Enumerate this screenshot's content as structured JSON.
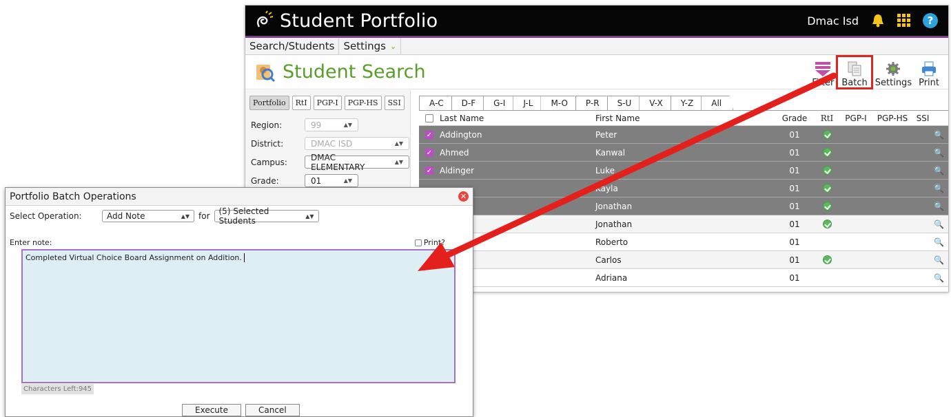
{
  "app": {
    "title": "Student Portfolio",
    "user": "Dmac Isd"
  },
  "menu": {
    "search_students": "Search/Students",
    "settings": "Settings"
  },
  "page": {
    "title": "Student Search"
  },
  "toolbar": {
    "filter": "Filter",
    "batch": "Batch",
    "settings": "Settings",
    "print": "Print"
  },
  "filters": {
    "module_tabs": [
      "Portfolio",
      "RtI",
      "PGP-I",
      "PGP-HS",
      "SSI"
    ],
    "region_label": "Region:",
    "region_value": "99",
    "district_label": "District:",
    "district_value": "DMAC ISD",
    "campus_label": "Campus:",
    "campus_value": "DMAC ELEMENTARY",
    "grade_label": "Grade:",
    "grade_value": "01"
  },
  "alpha_tabs": [
    "A-C",
    "D-F",
    "G-I",
    "J-L",
    "M-O",
    "P-R",
    "S-U",
    "V-X",
    "Y-Z",
    "All"
  ],
  "grid": {
    "headers": {
      "last": "Last Name",
      "first": "First Name",
      "grade": "Grade",
      "rti": "RtI",
      "pgpi": "PGP-I",
      "pgphs": "PGP-HS",
      "ssi": "SSI"
    },
    "rows": [
      {
        "last": "Addington",
        "first": "Peter",
        "grade": "01"
      },
      {
        "last": "Ahmed",
        "first": "Kanwal",
        "grade": "01"
      },
      {
        "last": "Aldinger",
        "first": "Luke",
        "grade": "01"
      },
      {
        "last": "",
        "first": "Kayla",
        "grade": "01"
      },
      {
        "last": "",
        "first": "Jonathan",
        "grade": "01"
      },
      {
        "last": "",
        "first": "Jonathan",
        "grade": "01"
      },
      {
        "last": "",
        "first": "Roberto",
        "grade": "01"
      },
      {
        "last": "",
        "first": "Carlos",
        "grade": "01"
      },
      {
        "last": "",
        "first": "Adriana",
        "grade": "01"
      }
    ]
  },
  "dialog": {
    "title": "Portfolio Batch Operations",
    "select_label": "Select Operation:",
    "operation": "Add Note",
    "for_label": "for",
    "target": "(5) Selected Students",
    "note_label": "Enter note:",
    "print_label": "Print?",
    "note_text": "Completed Virtual Choice Board Assignment on Addition.",
    "chars_left": "Characters Left:945",
    "execute": "Execute",
    "cancel": "Cancel"
  },
  "colors": {
    "accent_green": "#5a9e2a",
    "selected_row": "#7f7f7f",
    "highlight_red": "#e0261c",
    "checkbox_purple": "#b94fc0"
  }
}
